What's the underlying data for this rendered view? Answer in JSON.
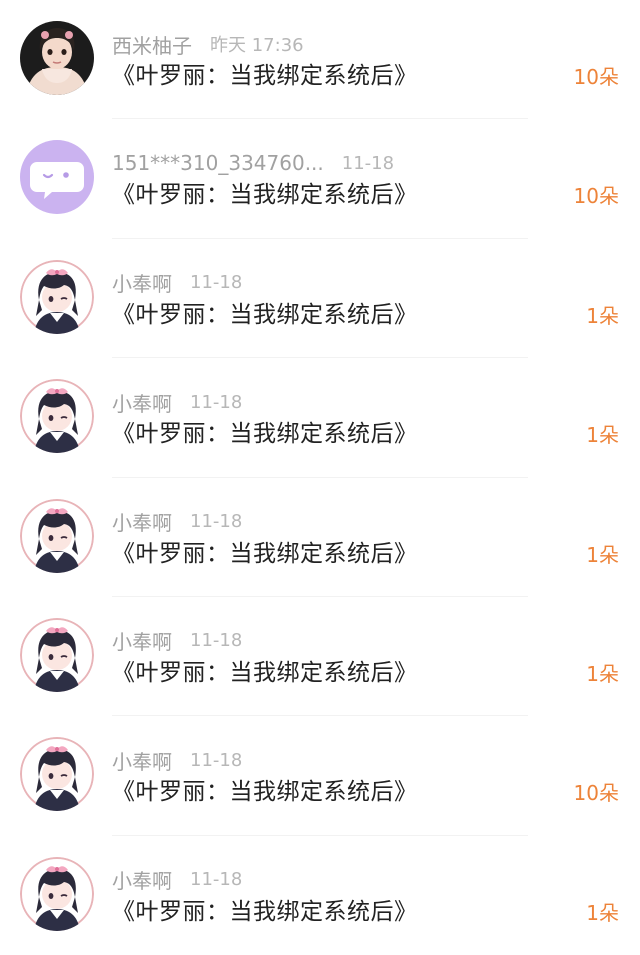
{
  "items": [
    {
      "avatar": "girl-photo-avatar",
      "name": "西米柚子",
      "time": "昨天 17:36",
      "title": "《叶罗丽：当我绑定系统后》",
      "gift": "10朵"
    },
    {
      "avatar": "chat-bubble-avatar",
      "name": "151***310_334760...",
      "time": "11-18",
      "title": "《叶罗丽：当我绑定系统后》",
      "gift": "10朵"
    },
    {
      "avatar": "anime-girl-avatar",
      "name": "小奉啊",
      "time": "11-18",
      "title": "《叶罗丽：当我绑定系统后》",
      "gift": "1朵"
    },
    {
      "avatar": "anime-girl-avatar",
      "name": "小奉啊",
      "time": "11-18",
      "title": "《叶罗丽：当我绑定系统后》",
      "gift": "1朵"
    },
    {
      "avatar": "anime-girl-avatar",
      "name": "小奉啊",
      "time": "11-18",
      "title": "《叶罗丽：当我绑定系统后》",
      "gift": "1朵"
    },
    {
      "avatar": "anime-girl-avatar",
      "name": "小奉啊",
      "time": "11-18",
      "title": "《叶罗丽：当我绑定系统后》",
      "gift": "1朵"
    },
    {
      "avatar": "anime-girl-avatar",
      "name": "小奉啊",
      "time": "11-18",
      "title": "《叶罗丽：当我绑定系统后》",
      "gift": "10朵"
    },
    {
      "avatar": "anime-girl-avatar",
      "name": "小奉啊",
      "time": "11-18",
      "title": "《叶罗丽：当我绑定系统后》",
      "gift": "1朵"
    }
  ],
  "colors": {
    "gift": "#ed8339",
    "name": "#a1a1a1",
    "title": "#222222",
    "chat_avatar_bg": "#cbb3f0"
  }
}
